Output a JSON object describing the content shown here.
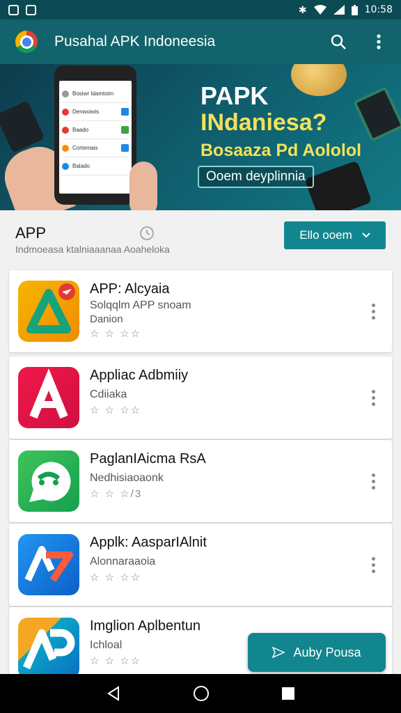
{
  "status_bar": {
    "time": "10:58"
  },
  "app_bar": {
    "title": "Pusahal APK Indoneesia",
    "search_icon": "search-icon",
    "menu_icon": "more-vert-icon"
  },
  "banner": {
    "heading_line1": "PAPK",
    "heading_line2": "INdaniesa?",
    "subtitle": "Bosaaza Pd Aololol",
    "pill": "Ooem deyplinnia",
    "phone_rows": [
      "Bosiwr Idamtoim",
      "Denwoiwis",
      "Baado",
      "Cortemais",
      "Balado"
    ]
  },
  "section": {
    "title": "APP",
    "subtitle": "Indmoeasa ktalniaaanaa Aoaheloka",
    "filter_label": "Ello ooem"
  },
  "apps": [
    {
      "name": "APP: Alcyaia",
      "line1": "Solqqlm APP snoam",
      "line2": "Danion",
      "rating": "☆ ☆ ☆☆"
    },
    {
      "name": "Appliac Adbmiiy",
      "line1": "Cdiiaka",
      "line2": "",
      "rating": "☆ ☆ ☆☆"
    },
    {
      "name": "PaglanIAicma RsA",
      "line1": "Nedhisiaoaonk",
      "line2": "",
      "rating": "☆ ☆ ☆/3"
    },
    {
      "name": "Applk: AasparIAlnit",
      "line1": "Alonnaraaoia",
      "line2": "",
      "rating": "☆ ☆ ☆☆"
    },
    {
      "name": "Imglion Aplbentun",
      "line1": "Ichloal",
      "line2": "",
      "rating": "☆ ☆ ☆☆"
    }
  ],
  "fab": {
    "label": "Auby Pousa"
  },
  "colors": {
    "teal_dark": "#0b4a52",
    "app_bar": "#12636b",
    "accent": "#12868f"
  }
}
